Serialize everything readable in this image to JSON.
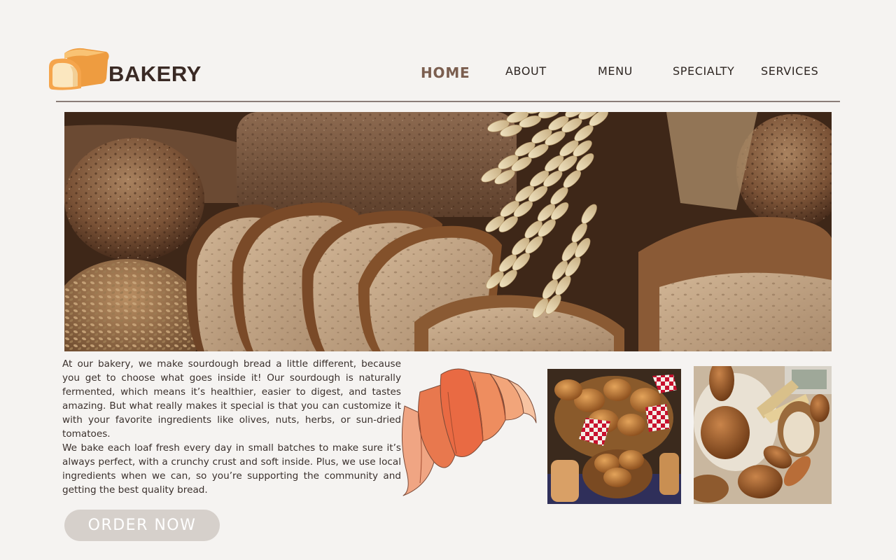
{
  "brand": {
    "name": "BAKERY",
    "logo_icon": "bread-loaf-icon"
  },
  "nav": {
    "items": [
      {
        "label": "HOME",
        "active": true
      },
      {
        "label": "ABOUT",
        "active": false
      },
      {
        "label": "MENU",
        "active": false
      },
      {
        "label": "SPECIALTY",
        "active": false
      },
      {
        "label": "SERVICES",
        "active": false
      }
    ]
  },
  "hero": {
    "image": "sliced-sourdough-bread-with-wheat"
  },
  "content": {
    "paragraphs": [
      "At our bakery, we make sourdough bread a little different, because you get to choose what goes inside it! Our sourdough is naturally fermented, which means it’s healthier, easier to digest, and tastes amazing. But what really makes it special is that you can customize it with your favorite ingredients like olives, nuts, herbs, or sun-dried tomatoes.",
      "We bake each loaf fresh every day in small batches to make sure it’s always perfect, with a crunchy crust and soft inside. Plus, we use local ingredients when we can, so you’re supporting the community and getting the best quality bread."
    ]
  },
  "cta": {
    "label": "ORDER NOW"
  },
  "gallery": {
    "items": [
      "watercolor-croissant",
      "bread-baskets-photo",
      "bread-basket-table-photo"
    ]
  },
  "colors": {
    "background": "#f5f3f1",
    "accent": "#7b5e4f",
    "button": "#d6d0cb"
  }
}
